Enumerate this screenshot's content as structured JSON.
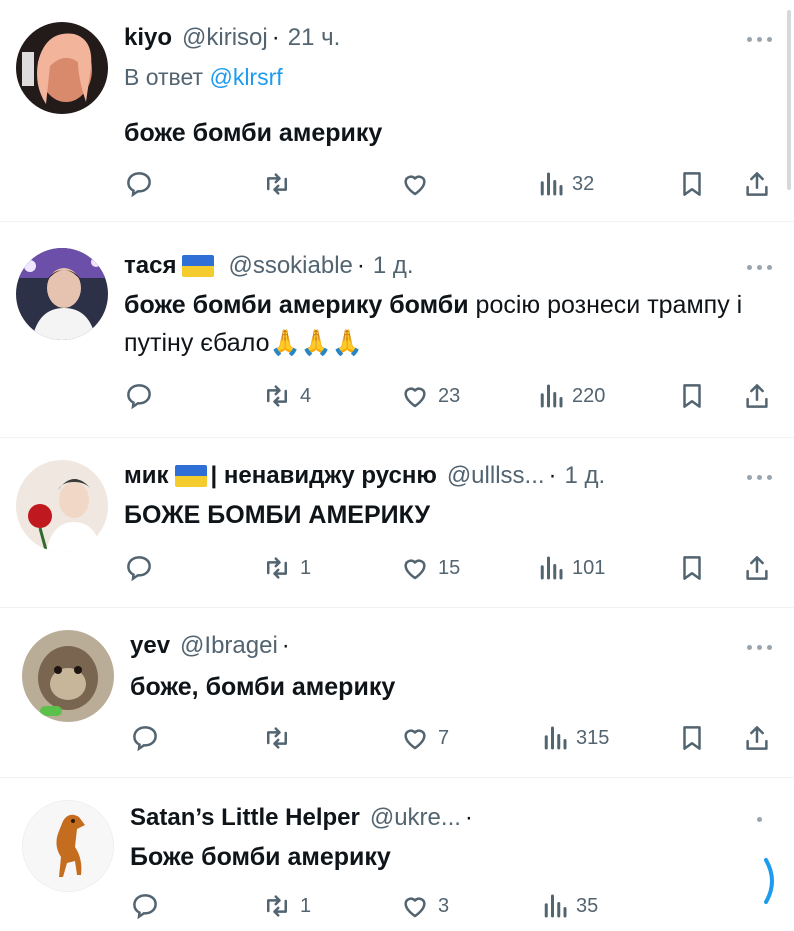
{
  "tweets": [
    {
      "name": "kiyo",
      "flag": false,
      "display_suffix": "",
      "handle": "@kirisoj",
      "time": "21 ч.",
      "reply_label": "В ответ",
      "reply_handle": "@klrsrf",
      "text_bold": "боже бомби америку",
      "text_rest": "",
      "emojis": "",
      "reply_count": "",
      "retweet_count": "",
      "like_count": "",
      "view_count": "32",
      "avatar_colors": [
        "#3b2a2a",
        "#f0a9a0",
        "#1a1414"
      ]
    },
    {
      "name": "тася",
      "flag": true,
      "display_suffix": "",
      "handle": "@ssokiable",
      "time": "1 д.",
      "reply_label": "",
      "reply_handle": "",
      "text_bold": "боже бомби америку бомби",
      "text_rest": " росію рознеси трампу і путіну єбало",
      "emojis": "🙏🙏🙏",
      "reply_count": "",
      "retweet_count": "4",
      "like_count": "23",
      "view_count": "220",
      "avatar_colors": [
        "#2d3550",
        "#9c7bd6",
        "#e2c3b5"
      ]
    },
    {
      "name": "мик",
      "flag": true,
      "display_suffix": "| ненавиджу русню",
      "handle": "@ulllss...",
      "time": "1 д.",
      "reply_label": "",
      "reply_handle": "",
      "text_bold": "",
      "text_rest": "БОЖЕ БОМБИ АМЕРИКУ",
      "emojis": "",
      "reply_count": "",
      "retweet_count": "1",
      "like_count": "15",
      "view_count": "101",
      "avatar_colors": [
        "#efe7e0",
        "#c0181f",
        "#3a3a3a"
      ]
    },
    {
      "name": "yev",
      "flag": false,
      "display_suffix": "",
      "handle": "@Ibragei",
      "time": "",
      "reply_label": "",
      "reply_handle": "",
      "text_bold": "боже, бомби америку",
      "text_rest": "",
      "emojis": "",
      "reply_count": "",
      "retweet_count": "",
      "like_count": "7",
      "view_count": "315",
      "avatar_colors": [
        "#a99b84",
        "#6c5a45",
        "#5cc14a"
      ]
    },
    {
      "name": "Satan’s Little Helper",
      "flag": false,
      "display_suffix": "",
      "handle": "@ukre...",
      "time": "",
      "reply_label": "",
      "reply_handle": "",
      "text_bold": "Боже бомби америку",
      "text_rest": "",
      "emojis": "",
      "reply_count": "",
      "retweet_count": "1",
      "like_count": "3",
      "view_count": "35",
      "avatar_colors": [
        "#f7f7f7",
        "#c46d1f",
        "#8b4a12"
      ]
    }
  ],
  "colors": {
    "text": "#0f1419",
    "secondary": "#536471",
    "link": "#1d9bf0",
    "divider": "#eff3f4",
    "flag_blue": "#2f6fd6",
    "flag_yellow": "#f5cc2e"
  },
  "icons": [
    "reply-icon",
    "retweet-icon",
    "like-icon",
    "views-icon",
    "bookmark-icon",
    "share-icon",
    "more-icon"
  ]
}
